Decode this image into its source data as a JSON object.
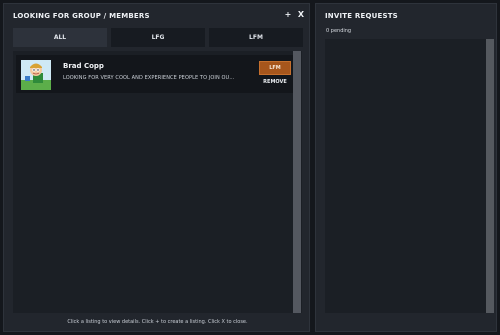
{
  "lfg_panel": {
    "title": "LOOKING FOR GROUP / MEMBERS",
    "add_label": "+",
    "close_label": "X",
    "tabs": [
      {
        "label": "ALL",
        "active": true
      },
      {
        "label": "LFG",
        "active": false
      },
      {
        "label": "LFM",
        "active": false
      }
    ],
    "listings": [
      {
        "name": "Brad Copp",
        "description": "LOOKING FOR VERY COOL AND EXPERIENCE PEOPLE TO JOIN OU...",
        "type_badge": "LFM",
        "remove_label": "REMOVE",
        "avatar_icon": "cartoon-character-avatar"
      }
    ],
    "footer_hint": "Click a listing to view details. Click + to create a listing. Click X to close."
  },
  "invite_panel": {
    "title": "INVITE REQUESTS",
    "pending_text": "0 pending"
  },
  "colors": {
    "background": "#14171c",
    "panel": "#22262d",
    "lfm_badge": "#a7561c"
  }
}
